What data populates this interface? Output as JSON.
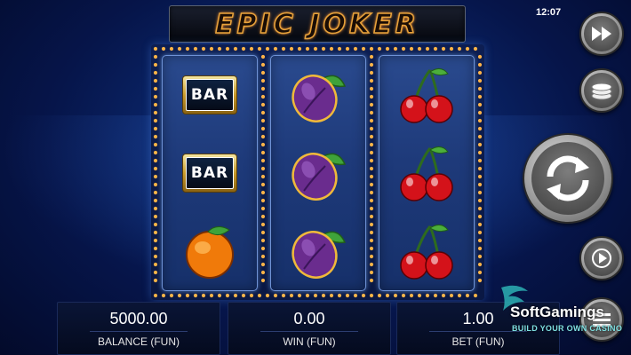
{
  "game": {
    "title": "EPIC JOKER"
  },
  "status": {
    "clock": "12:07"
  },
  "reels": [
    [
      "bar",
      "bar",
      "orange"
    ],
    [
      "plum",
      "plum",
      "plum"
    ],
    [
      "cherry",
      "cherry",
      "cherry"
    ]
  ],
  "symbols": {
    "bar_text": "BAR"
  },
  "controls": {
    "turbo": "fast-forward-icon",
    "bet": "coin-stack-icon",
    "spin": "spin-arrows-icon",
    "autoplay": "play-icon",
    "menu": "menu-icon"
  },
  "panels": {
    "balance": {
      "value": "5000.00",
      "label": "BALANCE (FUN)"
    },
    "win": {
      "value": "0.00",
      "label": "WIN (FUN)"
    },
    "bet": {
      "value": "1.00",
      "label": "BET (FUN)"
    }
  },
  "watermark": {
    "name": "SoftGamings",
    "tagline": "BUILD YOUR OWN CASINO"
  },
  "colors": {
    "background": "#0a2466",
    "title": "#e8a23a",
    "bulb": "#ffb347",
    "logo_accent": "#7fe0e2"
  }
}
